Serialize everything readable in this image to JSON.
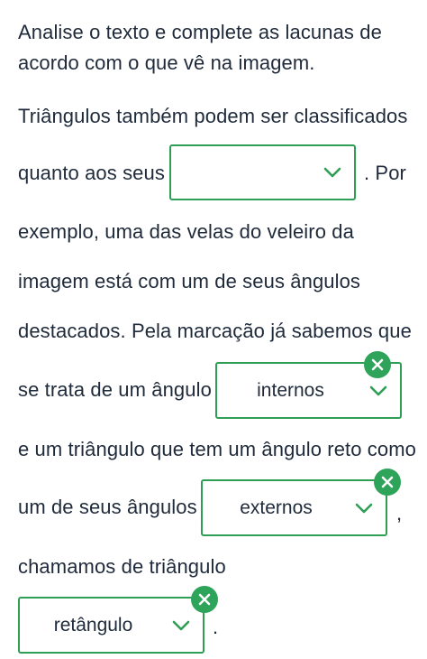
{
  "instructions": {
    "line1": "Analise o texto e complete as lacunas de",
    "line2": "acordo com o que vê na imagem."
  },
  "passage": {
    "line1": "Triângulos também podem ser classificados",
    "line2_before": "quanto aos seus",
    "line2_after": ". Por",
    "line3": "exemplo, uma das velas do veleiro da",
    "line4": "imagem está com um de seus ângulos",
    "line5": "destacados. Pela marcação já sabemos que",
    "line6_before": "se trata de um ângulo",
    "line7": "e um triângulo que tem um ângulo reto como",
    "line8_before": "um de seus ângulos",
    "line8_after": ",",
    "line9": "chamamos de triângulo",
    "line10_after": "."
  },
  "blanks": [
    {
      "value": "",
      "status": "empty",
      "icon": "chevron-down-icon"
    },
    {
      "value": "internos",
      "status": "incorrect",
      "icon": "close-icon"
    },
    {
      "value": "externos",
      "status": "incorrect",
      "icon": "close-icon"
    },
    {
      "value": "retângulo",
      "status": "incorrect",
      "icon": "close-icon"
    }
  ],
  "colors": {
    "accent_green": "#2ea35a",
    "text": "#1f2a3a"
  }
}
